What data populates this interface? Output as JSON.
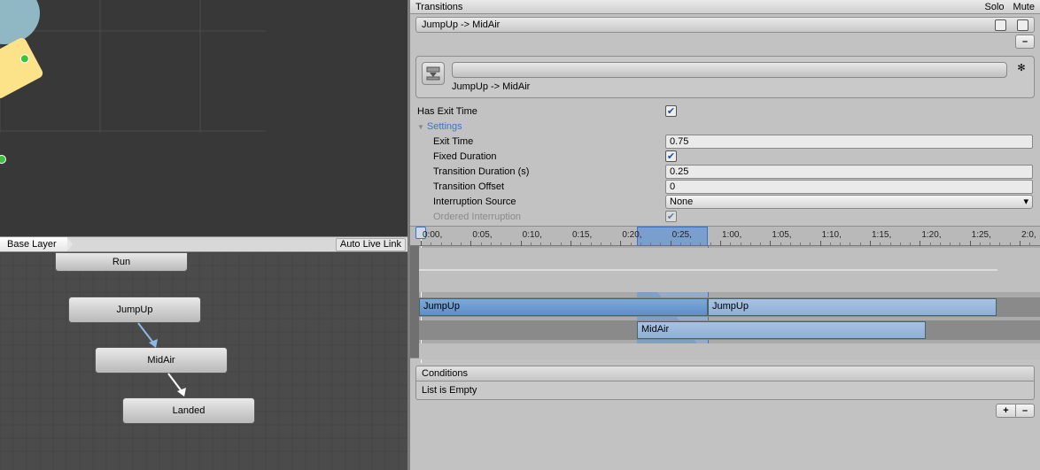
{
  "layerbar": {
    "crumb": "Base Layer",
    "auto_live_link": "Auto Live Link"
  },
  "nodes": {
    "run": "Run",
    "jumpup": "JumpUp",
    "midair": "MidAir",
    "landed": "Landed"
  },
  "header": {
    "title": "Transitions",
    "solo": "Solo",
    "mute": "Mute"
  },
  "listitem": "JumpUp -> MidAir",
  "transition_label": "JumpUp -> MidAir",
  "props": {
    "has_exit_time": {
      "label": "Has Exit Time",
      "checked": true
    },
    "settings": "Settings",
    "exit_time": {
      "label": "Exit Time",
      "value": "0.75"
    },
    "fixed_duration": {
      "label": "Fixed Duration",
      "checked": true
    },
    "transition_duration": {
      "label": "Transition Duration (s)",
      "value": "0.25"
    },
    "transition_offset": {
      "label": "Transition Offset",
      "value": "0"
    },
    "interruption_source": {
      "label": "Interruption Source",
      "value": "None"
    },
    "ordered_interruption": {
      "label": "Ordered Interruption",
      "checked": true
    }
  },
  "timeline": {
    "ticks": [
      "0:00",
      "0:05",
      "0:10",
      "0:15",
      "0:20",
      "0:25",
      "1:00",
      "1:05",
      "1:10",
      "1:15",
      "1:20",
      "1:25",
      "2:0"
    ],
    "clip_src": "JumpUp",
    "clip_src2": "JumpUp",
    "clip_dst": "MidAir"
  },
  "conditions": {
    "title": "Conditions",
    "empty": "List is Empty"
  },
  "chart_data": {
    "type": "timeline",
    "unit": "seconds",
    "range": [
      0,
      2.0
    ],
    "playhead": 0.0,
    "transition": {
      "start": 0.75,
      "end": 1.0
    },
    "tracks": [
      {
        "name": "JumpUp",
        "segments": [
          [
            0.0,
            1.0
          ],
          [
            1.0,
            2.0
          ]
        ]
      },
      {
        "name": "MidAir",
        "segments": [
          [
            0.75,
            1.75
          ]
        ]
      }
    ],
    "ticks_seconds": [
      0.0,
      0.167,
      0.333,
      0.5,
      0.667,
      0.833,
      1.0,
      1.167,
      1.333,
      1.5,
      1.667,
      1.833,
      2.0
    ]
  }
}
